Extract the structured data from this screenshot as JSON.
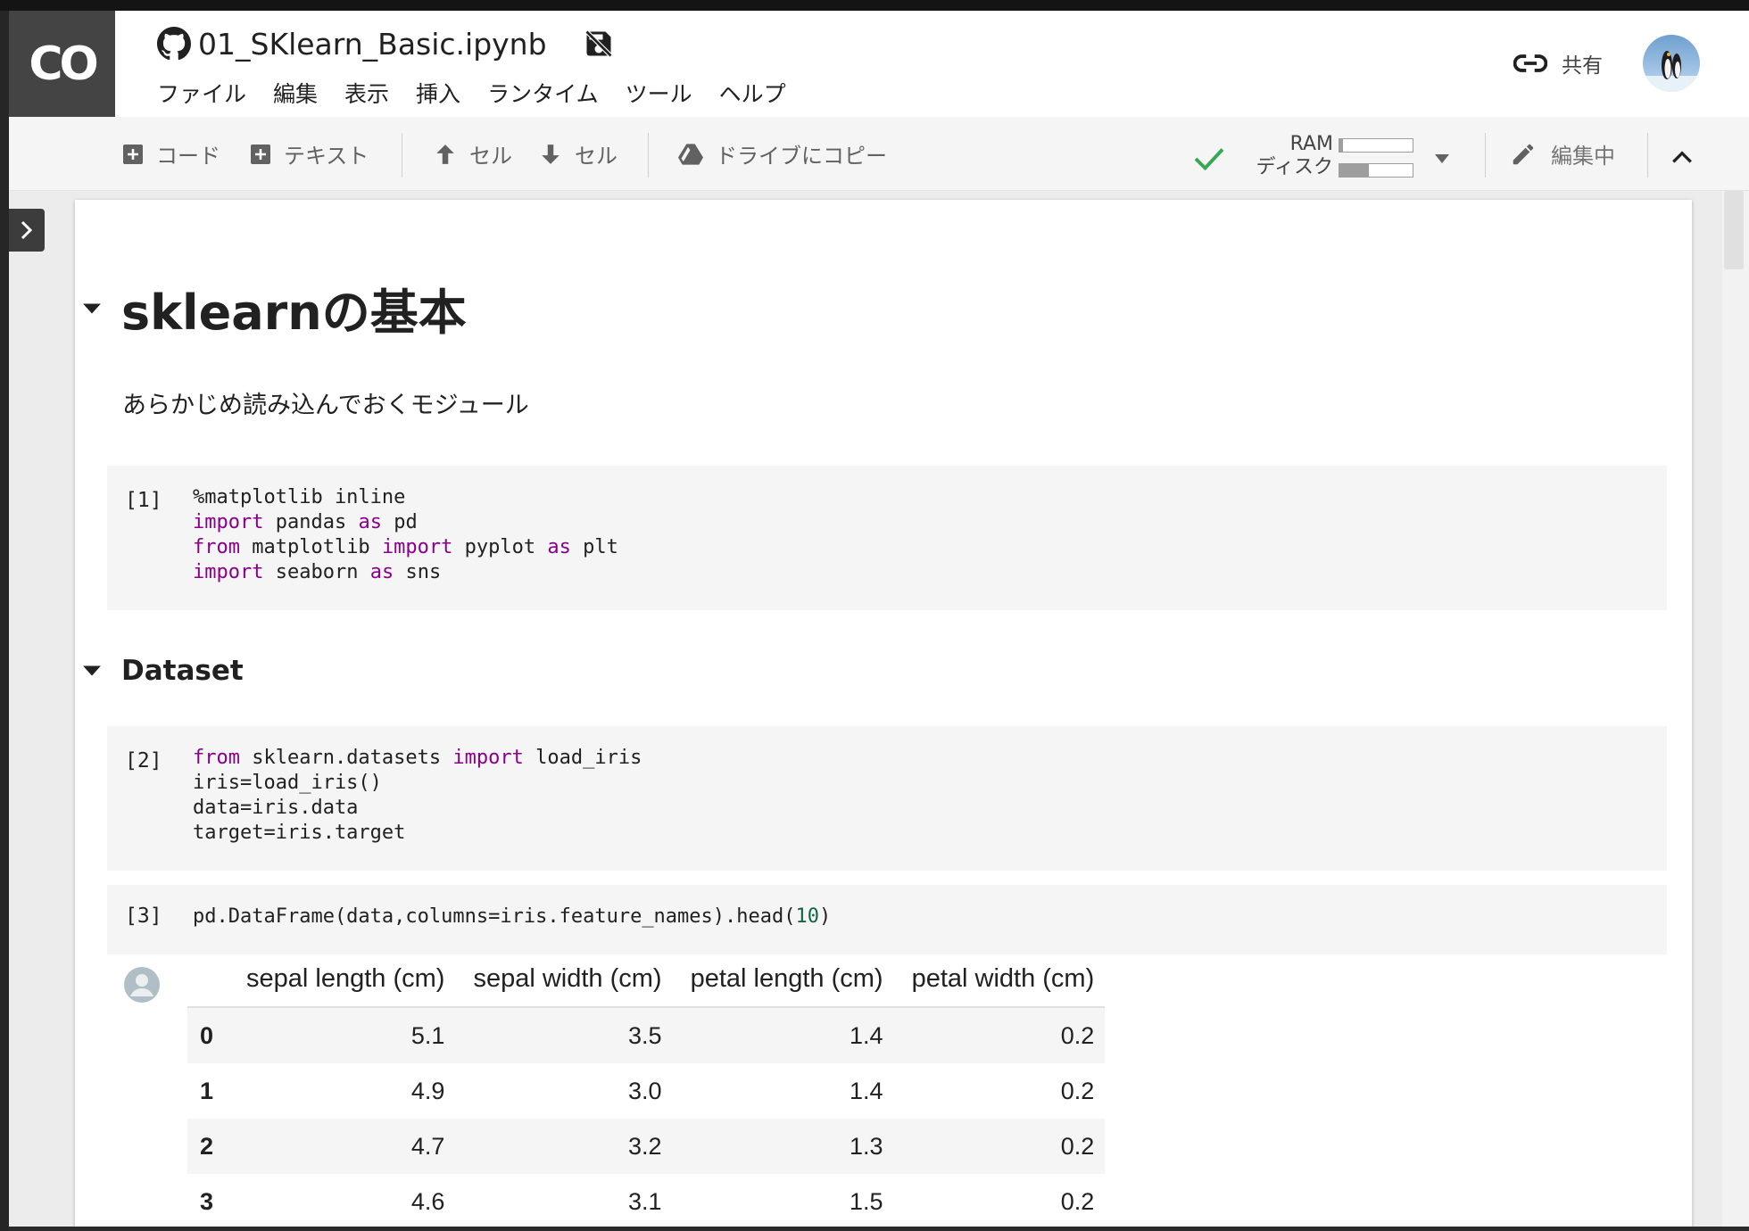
{
  "app": {
    "logo": "CO",
    "notebook_title": "01_SKlearn_Basic.ipynb",
    "menu": [
      "ファイル",
      "編集",
      "表示",
      "挿入",
      "ランタイム",
      "ツール",
      "ヘルプ"
    ],
    "share_label": "共有"
  },
  "toolbar": {
    "add_code": "コード",
    "add_text": "テキスト",
    "cell_up": "セル",
    "cell_down": "セル",
    "copy_to_drive": "ドライブにコピー",
    "ram_label": "RAM",
    "disk_label": "ディスク",
    "ram_usage": 0.05,
    "disk_usage": 0.4,
    "edit_mode": "編集中"
  },
  "notebook": {
    "heading": "sklearnの基本",
    "intro": "あらかじめ読み込んでおくモジュール",
    "section": "Dataset",
    "cells": [
      {
        "num": "[1]",
        "lines": [
          [
            {
              "t": "%matplotlib inline"
            }
          ],
          [
            {
              "t": "import",
              "k": 1
            },
            {
              "t": " pandas "
            },
            {
              "t": "as",
              "k": 1
            },
            {
              "t": " pd"
            }
          ],
          [
            {
              "t": "from",
              "k": 1
            },
            {
              "t": " matplotlib "
            },
            {
              "t": "import",
              "k": 1
            },
            {
              "t": " pyplot "
            },
            {
              "t": "as",
              "k": 1
            },
            {
              "t": " plt"
            }
          ],
          [
            {
              "t": "import",
              "k": 1
            },
            {
              "t": " seaborn "
            },
            {
              "t": "as",
              "k": 1
            },
            {
              "t": " sns"
            }
          ]
        ]
      },
      {
        "num": "[2]",
        "lines": [
          [
            {
              "t": "from",
              "k": 1
            },
            {
              "t": " sklearn.datasets "
            },
            {
              "t": "import",
              "k": 1
            },
            {
              "t": " load_iris"
            }
          ],
          [
            {
              "t": "iris=load_iris()"
            }
          ],
          [
            {
              "t": "data=iris.data"
            }
          ],
          [
            {
              "t": "target=iris.target"
            }
          ]
        ]
      },
      {
        "num": "[3]",
        "lines": [
          [
            {
              "t": "pd.DataFrame(data,columns=iris.feature_names).head("
            },
            {
              "t": "10",
              "n": 1
            },
            {
              "t": ")"
            }
          ]
        ]
      }
    ],
    "table": {
      "columns": [
        "sepal length (cm)",
        "sepal width (cm)",
        "petal length (cm)",
        "petal width (cm)"
      ],
      "rows": [
        {
          "index": "0",
          "values": [
            "5.1",
            "3.5",
            "1.4",
            "0.2"
          ]
        },
        {
          "index": "1",
          "values": [
            "4.9",
            "3.0",
            "1.4",
            "0.2"
          ]
        },
        {
          "index": "2",
          "values": [
            "4.7",
            "3.2",
            "1.3",
            "0.2"
          ]
        },
        {
          "index": "3",
          "values": [
            "4.6",
            "3.1",
            "1.5",
            "0.2"
          ]
        }
      ]
    }
  },
  "colors": {
    "keyword": "#8b008b",
    "number": "#116644",
    "logo_bg": "#444444",
    "status_ok": "#34a853"
  }
}
